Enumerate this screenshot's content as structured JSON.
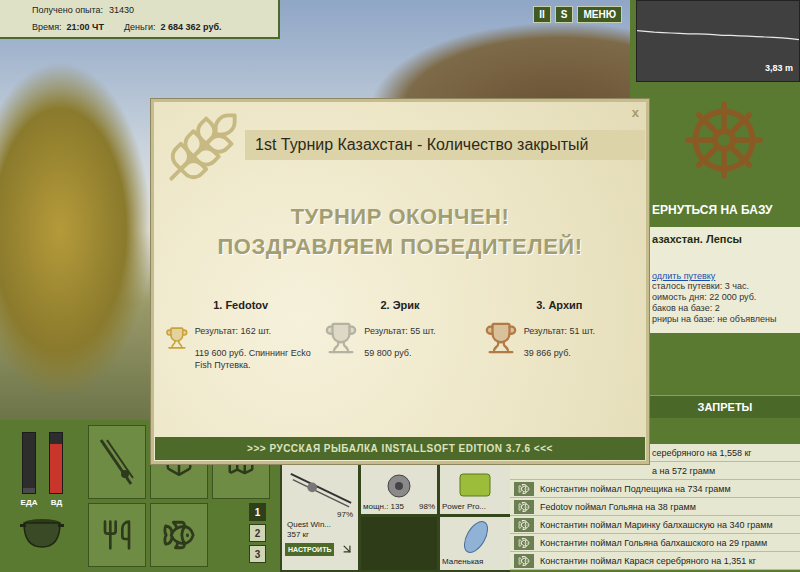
{
  "hud": {
    "experience": {
      "label": "Получено опыта:",
      "value": "31430"
    },
    "time": {
      "label": "Время:",
      "value": "21:00 ЧТ"
    },
    "money": {
      "label": "Деньги:",
      "value": "2 684 362 руб."
    }
  },
  "top_buttons": [
    "II",
    "S",
    "МЕНЮ"
  ],
  "depth_chart": {
    "values": [
      2.7,
      2.8,
      2.9,
      2.95,
      3.0,
      3.05,
      3.1,
      3.1,
      3.15,
      3.2,
      3.3,
      3.3,
      3.35,
      3.4,
      3.45,
      3.5,
      3.55,
      3.6,
      3.7,
      3.83
    ],
    "reading": "3,83 m"
  },
  "base_panel": {
    "return_button": "ЕРНУТЬСЯ НА БАЗУ",
    "title": "азахстан. Лепсы",
    "link": "одлить путевку",
    "lines": [
      "сталось путевки: 3 час.",
      "оимость дня: 22 000 руб.",
      "баков на базе: 2",
      "рниры на базе: не объявлены"
    ]
  },
  "bans_button": "ЗАПРЕТЫ",
  "meters": [
    {
      "label": "ЕДА",
      "level": 0.08,
      "color": "#4a4a4a"
    },
    {
      "label": "ВД",
      "level": 0.82,
      "color": "#c8352b"
    }
  ],
  "action_tabs": [
    {
      "label": "1",
      "selected": true
    },
    {
      "label": "2",
      "selected": false
    },
    {
      "label": "3",
      "selected": false
    }
  ],
  "tackle": {
    "rod": {
      "wear": "97%",
      "name": "Quest Win...",
      "load": "357 кг",
      "button": "НАСТРОИТЬ"
    },
    "reel": {
      "power": "мощн.: 135",
      "wear": "98%"
    },
    "line": {
      "name": "Power Pro..."
    },
    "lure": {
      "name": "Маленькая"
    }
  },
  "catch_log": [
    {
      "text": "серебряного на 1,558 кг",
      "clipped": true
    },
    {
      "text": "а на 572 грамм",
      "clipped": true
    },
    {
      "text": "Константин поймал Подлещика на 734 грамм",
      "clipped": false
    },
    {
      "text": "Fedotov поймал Гольяна на 38 грамм",
      "clipped": false
    },
    {
      "text": "Константин поймал Маринку балхашскую на 340 грамм",
      "clipped": false
    },
    {
      "text": "Константин поймал Гольяна балхашского на 29 грамм",
      "clipped": false
    },
    {
      "text": "Константин поймал Карася серебряного на 1,351 кг",
      "clipped": false
    }
  ],
  "tournament": {
    "title": "1st Турнир Казахстан - Количество закрытый",
    "close": "x",
    "headline": [
      "ТУРНИР ОКОНЧЕН!",
      "ПОЗДРАВЛЯЕМ ПОБЕДИТЕЛЕЙ!"
    ],
    "winners": [
      {
        "place": "1. Fedotov",
        "result": "Результат: 162 шт.",
        "prize": "119 600 руб. Спиннинг Ecko Fish Путевка.",
        "color": "#c9a23c"
      },
      {
        "place": "2. Эрик",
        "result": "Результат: 55 шт.",
        "prize": "59 800 руб.",
        "color": "#b4b3a3"
      },
      {
        "place": "3. Архип",
        "result": "Результат: 51 шт.",
        "prize": "39 866 руб.",
        "color": "#b27a45"
      }
    ],
    "footer": ">>> РУССКАЯ РЫБАЛКА INSTALLSOFT EDITION 3.7.6 <<<"
  }
}
